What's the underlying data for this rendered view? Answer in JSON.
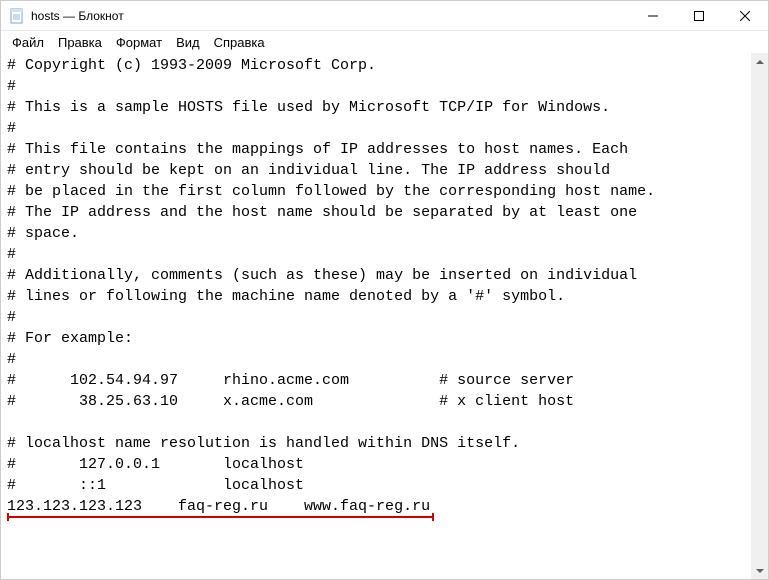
{
  "window": {
    "title": "hosts — Блокнот"
  },
  "menu": {
    "file": "Файл",
    "edit": "Правка",
    "format": "Формат",
    "view": "Вид",
    "help": "Справка"
  },
  "content": "# Copyright (c) 1993-2009 Microsoft Corp.\n#\n# This is a sample HOSTS file used by Microsoft TCP/IP for Windows.\n#\n# This file contains the mappings of IP addresses to host names. Each\n# entry should be kept on an individual line. The IP address should\n# be placed in the first column followed by the corresponding host name.\n# The IP address and the host name should be separated by at least one\n# space.\n#\n# Additionally, comments (such as these) may be inserted on individual\n# lines or following the machine name denoted by a '#' symbol.\n#\n# For example:\n#\n#      102.54.94.97     rhino.acme.com          # source server\n#       38.25.63.10     x.acme.com              # x client host\n\n# localhost name resolution is handled within DNS itself.\n#       127.0.0.1       localhost\n#       ::1             localhost\n123.123.123.123    faq-reg.ru    www.faq-reg.ru",
  "annotation": {
    "underline_line": 22
  }
}
